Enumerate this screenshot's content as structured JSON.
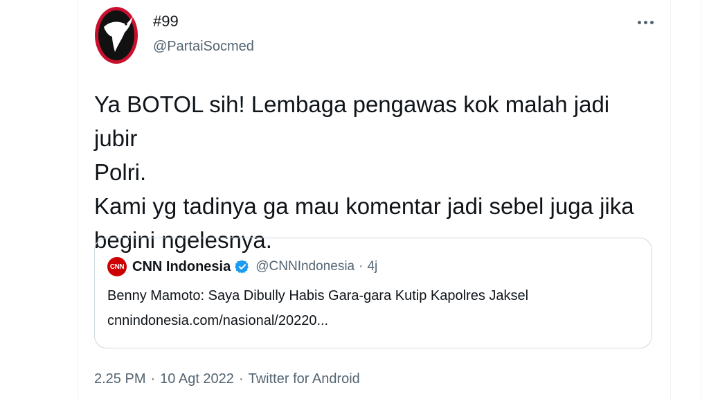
{
  "author": {
    "display_name": "#99",
    "handle": "@PartaiSocmed"
  },
  "tweet": {
    "text": "Ya BOTOL sih! Lembaga pengawas kok malah jadi jubir\nPolri.\nKami yg tadinya ga mau komentar jadi sebel juga jika\nbegini ngelesnya."
  },
  "quote": {
    "logo_text": "CNN",
    "name": "CNN Indonesia",
    "handle": "@CNNIndonesia",
    "separator": "·",
    "time": "4j",
    "title": "Benny Mamoto: Saya Dibully Habis Gara-gara Kutip Kapolres Jaksel",
    "link": "cnnindonesia.com/nasional/20220..."
  },
  "meta": {
    "time": "2.25 PM",
    "separator": "·",
    "date": "10 Agt 2022",
    "source": "Twitter for Android"
  },
  "icons": {
    "avatar": "avatar-logo-icon",
    "more": "more-options-icon",
    "verified": "verified-badge-icon"
  },
  "colors": {
    "text": "#0f1419",
    "secondary": "#536471",
    "border": "#cfd9de",
    "verified": "#1d9bf0",
    "cnn_red": "#cc0000",
    "avatar_red": "#c8102e"
  }
}
